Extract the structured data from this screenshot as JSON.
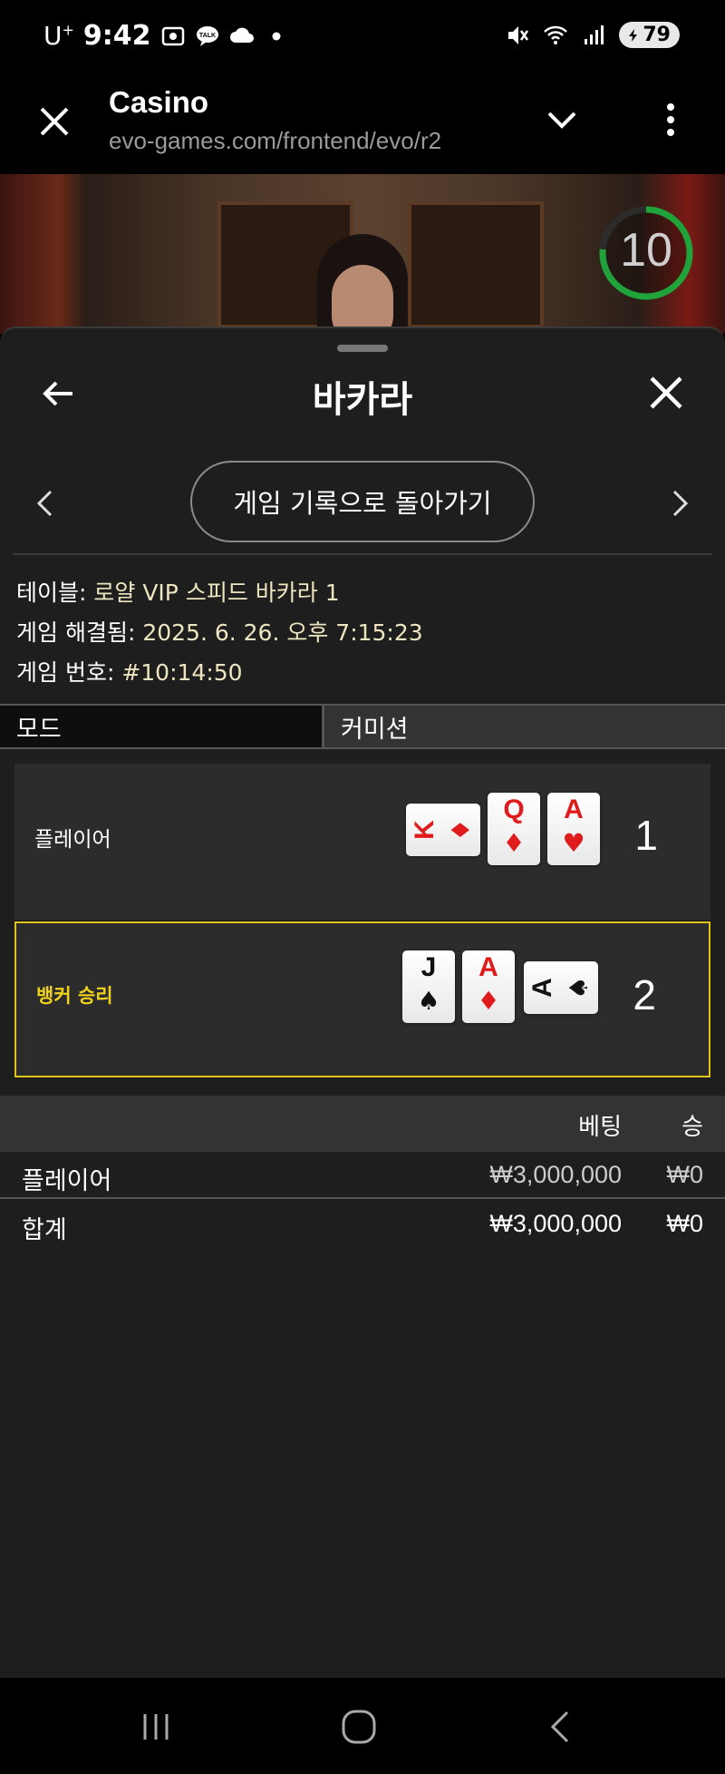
{
  "status_bar": {
    "carrier": "U",
    "carrier_sup": "+",
    "time": "9:42",
    "battery": "79",
    "icons": [
      "screenshot-icon",
      "talk-icon",
      "cloud-icon",
      "dot-icon",
      "mute-icon",
      "wifi-icon",
      "signal-icon",
      "battery-icon"
    ]
  },
  "browser": {
    "title": "Casino",
    "url": "evo-games.com/frontend/evo/r2"
  },
  "video": {
    "timer": "10",
    "timer_color": "#1fa33a"
  },
  "sheet": {
    "title": "바카라",
    "back_history_label": "게임 기록으로 돌아가기",
    "table_label": "테이블: ",
    "table_value": "로얄 VIP 스피드 바카라 1",
    "resolved_label": "게임 해결됨: ",
    "resolved_value": "2025. 6. 26. 오후 7:15:23",
    "number_label": "게임 번호: ",
    "number_value": "#10:14:50",
    "tabs": [
      "모드",
      "커미션"
    ]
  },
  "hands": {
    "player": {
      "label": "플레이어",
      "score": "1",
      "cards": [
        {
          "rank": "K",
          "suit": "♦",
          "color": "red",
          "orientation": "sideways"
        },
        {
          "rank": "Q",
          "suit": "♦",
          "color": "red",
          "orientation": "upright"
        },
        {
          "rank": "A",
          "suit": "♥",
          "color": "red",
          "orientation": "upright"
        }
      ]
    },
    "banker": {
      "label": "뱅커 승리",
      "score": "2",
      "cards": [
        {
          "rank": "J",
          "suit": "♠",
          "color": "black",
          "orientation": "upright"
        },
        {
          "rank": "A",
          "suit": "♦",
          "color": "red",
          "orientation": "upright"
        },
        {
          "rank": "A",
          "suit": "♠",
          "color": "black",
          "orientation": "sideways"
        }
      ]
    }
  },
  "bets": {
    "headers": {
      "bet": "베팅",
      "win": "승"
    },
    "rows": [
      {
        "name": "플레이어",
        "bet": "₩3,000,000",
        "win": "₩0"
      },
      {
        "name": "합계",
        "bet": "₩3,000,000",
        "win": "₩0"
      }
    ]
  },
  "accent_color": "#e0c21a"
}
